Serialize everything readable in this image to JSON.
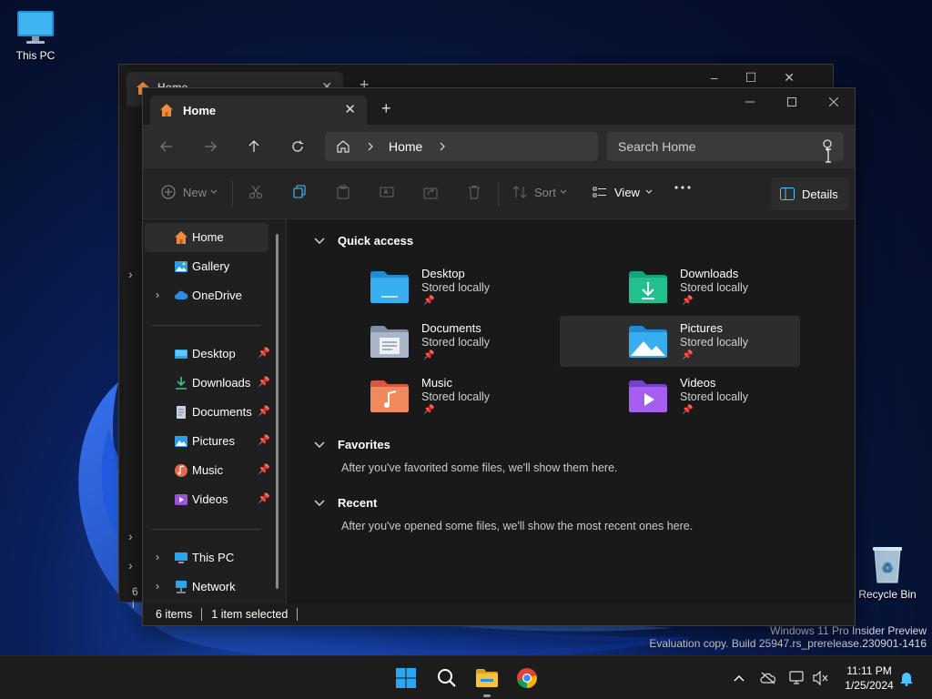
{
  "desktop": {
    "this_pc_label": "This PC",
    "recycle_bin_label": "Recycle Bin",
    "watermark_line1": "Windows 11 Pro Insider Preview",
    "watermark_line2": "Evaluation copy. Build 25947.rs_prerelease.230901-1416"
  },
  "back_window": {
    "tab_title": "Home",
    "status_text": "6 i"
  },
  "window": {
    "tab_title": "Home",
    "new_tab_label": "+",
    "address": {
      "location": "Home"
    },
    "search": {
      "placeholder": "Search Home"
    },
    "commands": {
      "new_label": "New",
      "sort_label": "Sort",
      "view_label": "View",
      "details_label": "Details"
    },
    "sidebar": {
      "top_items": [
        {
          "label": "Home"
        },
        {
          "label": "Gallery"
        },
        {
          "label": "OneDrive"
        }
      ],
      "pinned_items": [
        {
          "label": "Desktop"
        },
        {
          "label": "Downloads"
        },
        {
          "label": "Documents"
        },
        {
          "label": "Pictures"
        },
        {
          "label": "Music"
        },
        {
          "label": "Videos"
        }
      ],
      "bottom_items": [
        {
          "label": "This PC"
        },
        {
          "label": "Network"
        }
      ]
    },
    "sections": {
      "quick_access": "Quick access",
      "favorites": "Favorites",
      "favorites_empty": "After you've favorited some files, we'll show them here.",
      "recent": "Recent",
      "recent_empty": "After you've opened some files, we'll show the most recent ones here."
    },
    "quick_access": [
      {
        "name": "Desktop",
        "sub": "Stored locally"
      },
      {
        "name": "Downloads",
        "sub": "Stored locally"
      },
      {
        "name": "Documents",
        "sub": "Stored locally"
      },
      {
        "name": "Pictures",
        "sub": "Stored locally"
      },
      {
        "name": "Music",
        "sub": "Stored locally"
      },
      {
        "name": "Videos",
        "sub": "Stored locally"
      }
    ],
    "status": {
      "items_count": "6 items",
      "selected": "1 item selected"
    }
  },
  "taskbar": {
    "time": "11:11 PM",
    "date": "1/25/2024"
  },
  "colors": {
    "accent": "#4cc2ff",
    "home_icon": "#f08c3c"
  }
}
